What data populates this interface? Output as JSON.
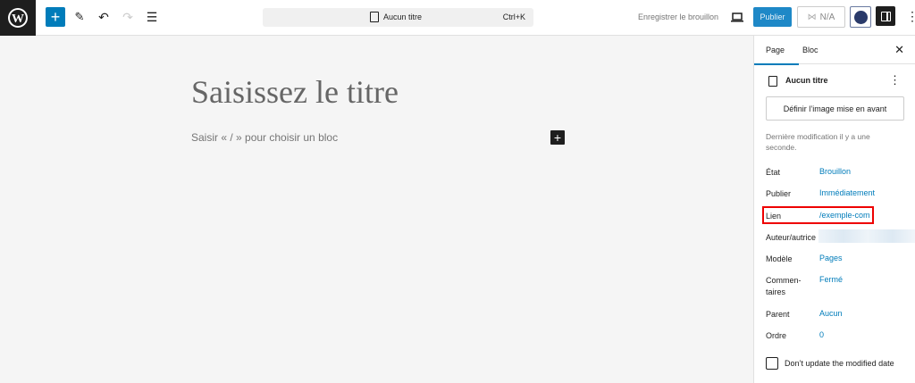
{
  "toolbar": {
    "command_title": "Aucun titre",
    "shortcut": "Ctrl+K",
    "save_draft": "Enregistrer le brouillon",
    "publish": "Publier",
    "seo_score": "N/A"
  },
  "editor": {
    "title_placeholder": "Saisissez le titre",
    "block_placeholder": "Saisir « / » pour choisir un bloc"
  },
  "sidebar": {
    "tabs": [
      "Page",
      "Bloc"
    ],
    "doc_title": "Aucun titre",
    "featured_image_button": "Définir l’image mise en avant",
    "last_modified": "Dernière modification il y a une seconde.",
    "rows": [
      {
        "label": "État",
        "value": "Brouillon"
      },
      {
        "label": "Publier",
        "value": "Immédiatement"
      },
      {
        "label": "Lien",
        "value": "/exemple-com"
      },
      {
        "label": "Auteur/autrice",
        "value": ""
      },
      {
        "label": "Modèle",
        "value": "Pages"
      },
      {
        "label": "Commen-taires",
        "value": "Fermé"
      },
      {
        "label": "Parent",
        "value": "Aucun"
      },
      {
        "label": "Ordre",
        "value": "0"
      }
    ],
    "checkbox_label": "Don’t update the modified date"
  },
  "colors": {
    "accent": "#007cba",
    "highlight": "#e00000"
  }
}
